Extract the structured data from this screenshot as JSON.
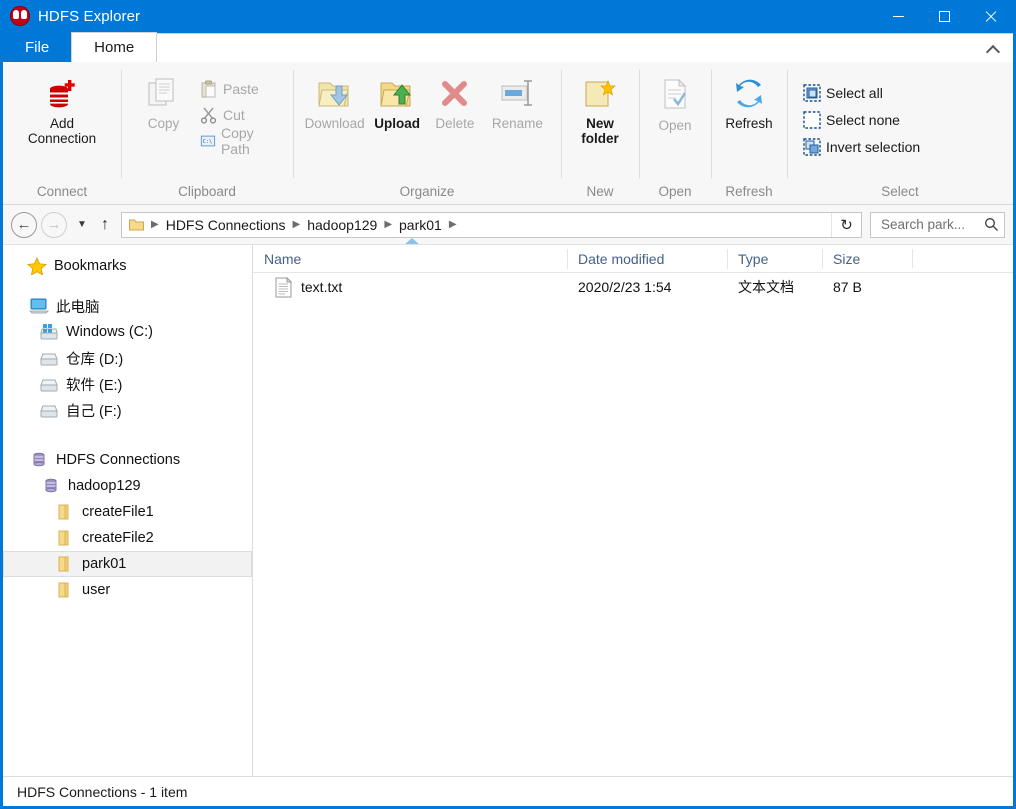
{
  "window": {
    "title": "HDFS Explorer",
    "logo_color": "#c00418",
    "accent_color": "#0078d7",
    "controls": {
      "minimize": "minimize",
      "maximize": "maximize",
      "close": "close"
    }
  },
  "tabs": {
    "file": "File",
    "home": "Home",
    "collapse_ribbon": "collapse-ribbon"
  },
  "ribbon": {
    "groups": [
      {
        "label": "Connect",
        "buttons": [
          {
            "label_line1": "Add",
            "label_line2": "Connection",
            "icon": "database-plus-icon",
            "enabled": true
          }
        ]
      },
      {
        "label": "Clipboard",
        "buttons": [
          {
            "label_line1": "Copy",
            "label_line2": "",
            "icon": "copy-icon",
            "enabled": false
          }
        ],
        "small_buttons": [
          {
            "label": "Paste",
            "icon": "paste-icon",
            "enabled": false
          },
          {
            "label": "Cut",
            "icon": "scissors-icon",
            "enabled": false
          },
          {
            "label": "Copy Path",
            "icon": "copy-path-icon",
            "enabled": false
          }
        ]
      },
      {
        "label": "Organize",
        "buttons": [
          {
            "label_line1": "Download",
            "label_line2": "",
            "icon": "folder-download-icon",
            "enabled": false
          },
          {
            "label_line1": "Upload",
            "label_line2": "",
            "icon": "folder-upload-icon",
            "enabled": true
          },
          {
            "label_line1": "Delete",
            "label_line2": "",
            "icon": "delete-x-icon",
            "enabled": false
          },
          {
            "label_line1": "Rename",
            "label_line2": "",
            "icon": "rename-icon",
            "enabled": false
          }
        ]
      },
      {
        "label": "New",
        "buttons": [
          {
            "label_line1": "New",
            "label_line2": "folder",
            "icon": "new-folder-icon",
            "enabled": true
          }
        ]
      },
      {
        "label": "Open",
        "buttons": [
          {
            "label_line1": "Open",
            "label_line2": "",
            "icon": "open-document-icon",
            "enabled": false
          }
        ]
      },
      {
        "label": "Refresh",
        "buttons": [
          {
            "label_line1": "Refresh",
            "label_line2": "",
            "icon": "refresh-arrows-icon",
            "enabled": true
          }
        ]
      },
      {
        "label": "Select",
        "small_buttons": [
          {
            "label": "Select all",
            "icon": "select-all-icon",
            "enabled": true
          },
          {
            "label": "Select none",
            "icon": "select-none-icon",
            "enabled": true
          },
          {
            "label": "Invert selection",
            "icon": "invert-selection-icon",
            "enabled": true
          }
        ]
      }
    ]
  },
  "addressbar": {
    "back": "back-arrow",
    "forward": "forward-arrow",
    "recent": "recent-dropdown",
    "up": "up-arrow",
    "breadcrumbs": [
      "HDFS Connections",
      "hadoop129",
      "park01"
    ],
    "refresh": "refresh-icon",
    "search_placeholder": "Search park...",
    "search_value": "",
    "search_icon": "search-icon"
  },
  "sidebar": {
    "bookmarks": {
      "label": "Bookmarks",
      "icon": "star-icon"
    },
    "this_pc": {
      "label": "此电脑",
      "icon": "computer-icon"
    },
    "drives": [
      {
        "label": "Windows (C:)",
        "icon": "windows-drive-icon"
      },
      {
        "label": "仓库 (D:)",
        "icon": "drive-icon"
      },
      {
        "label": "软件 (E:)",
        "icon": "drive-icon"
      },
      {
        "label": "自己 (F:)",
        "icon": "drive-icon"
      }
    ],
    "connections_root": {
      "label": "HDFS Connections",
      "icon": "database-icon"
    },
    "connection": {
      "label": "hadoop129",
      "icon": "database-icon"
    },
    "folders": [
      {
        "label": "createFile1",
        "icon": "folder-icon",
        "selected": false
      },
      {
        "label": "createFile2",
        "icon": "folder-icon",
        "selected": false
      },
      {
        "label": "park01",
        "icon": "folder-icon",
        "selected": true
      },
      {
        "label": "user",
        "icon": "folder-icon",
        "selected": false
      }
    ]
  },
  "filelist": {
    "columns": [
      "Name",
      "Date modified",
      "Type",
      "Size"
    ],
    "sort_column": "Name",
    "sort_direction": "ascending",
    "rows": [
      {
        "name": "text.txt",
        "date_modified": "2020/2/23 1:54",
        "type": "文本文档",
        "size": "87 B",
        "icon": "text-file-icon"
      }
    ]
  },
  "statusbar": {
    "text": "HDFS Connections - 1 item"
  }
}
